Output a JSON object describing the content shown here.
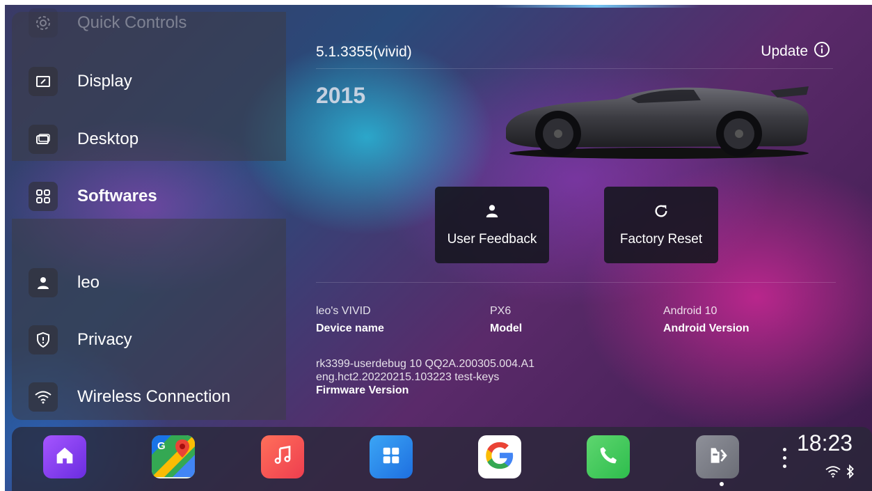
{
  "sidebar": {
    "items": [
      {
        "label": "Quick Controls",
        "icon": "gear-icon"
      },
      {
        "label": "Display",
        "icon": "display-icon"
      },
      {
        "label": "Desktop",
        "icon": "desktop-icon"
      },
      {
        "label": "Softwares",
        "icon": "grid-icon"
      },
      {
        "label": "leo",
        "icon": "person-icon"
      },
      {
        "label": "Privacy",
        "icon": "shield-icon"
      },
      {
        "label": "Wireless Connection",
        "icon": "wifi-icon"
      }
    ],
    "active": "Softwares"
  },
  "main": {
    "version": "5.1.3355(vivid)",
    "update_label": "Update",
    "year": "2015",
    "actions": [
      {
        "label": "User Feedback",
        "icon": "person-icon"
      },
      {
        "label": "Factory Reset",
        "icon": "refresh-icon"
      }
    ],
    "info": [
      {
        "value": "leo's VIVID",
        "key": "Device name"
      },
      {
        "value": "PX6",
        "key": "Model"
      },
      {
        "value": "Android 10",
        "key": "Android Version"
      }
    ],
    "firmware": {
      "line1": "rk3399-userdebug 10 QQ2A.200305.004.A1",
      "line2": "eng.hct2.20220215.103223 test-keys",
      "key": "Firmware Version"
    }
  },
  "dock": {
    "apps": [
      {
        "name": "home",
        "icon": "home-icon",
        "color": "#8b3df0"
      },
      {
        "name": "maps",
        "icon": "maps-icon",
        "color": "#34a853"
      },
      {
        "name": "music",
        "icon": "music-note-icon",
        "color": "#f2584a"
      },
      {
        "name": "apps",
        "icon": "apps-grid-icon",
        "color": "#1e88e5"
      },
      {
        "name": "google",
        "icon": "google-icon",
        "color": "#ffffff"
      },
      {
        "name": "phone",
        "icon": "phone-icon",
        "color": "#3ec45c"
      },
      {
        "name": "car settings",
        "icon": "car-seat-icon",
        "color": "#7d7f88"
      }
    ],
    "time": "18:23",
    "status_icons": [
      "wifi-icon",
      "bluetooth-icon"
    ]
  }
}
